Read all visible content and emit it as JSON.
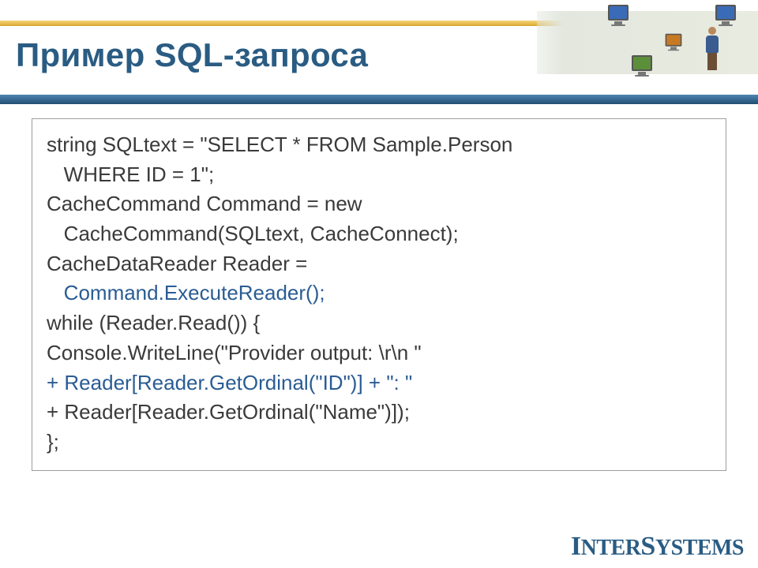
{
  "header": {
    "title": "Пример SQL-запроса",
    "logo_text": "InterSystems"
  },
  "code": {
    "line1a": "string SQLtext = \"SELECT * FROM Sample.Person",
    "line1b": "   WHERE ID = 1\";",
    "line2a": "CacheCommand Command = new",
    "line2b": "   CacheCommand(SQLtext, CacheConnect);",
    "line3a": "CacheDataReader Reader =",
    "line3b_hl": "   Command.ExecuteReader();",
    "line4": "while (Reader.Read()) {",
    "line5": "Console.WriteLine(\"Provider output: \\r\\n \"",
    "line6_hl": "+ Reader[Reader.GetOrdinal(\"ID\")] + \": \"",
    "line7": "+ Reader[Reader.GetOrdinal(\"Name\")]);",
    "line8": "};"
  }
}
